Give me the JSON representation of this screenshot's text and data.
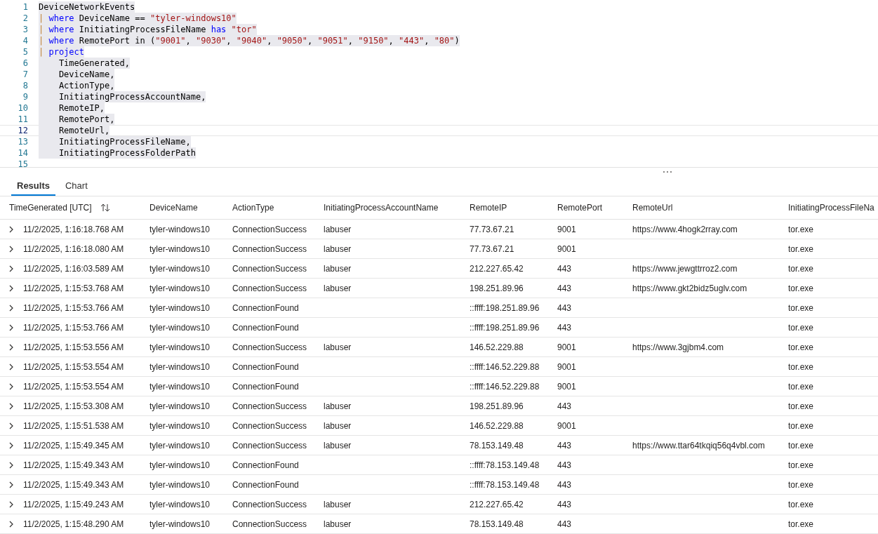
{
  "editor": {
    "lines": [
      {
        "number": "1",
        "current": false,
        "tokens": [
          {
            "kind": "plain",
            "text": "DeviceNetworkEvents"
          }
        ]
      },
      {
        "number": "2",
        "current": false,
        "tokens": [
          {
            "kind": "pipe",
            "text": "|"
          },
          {
            "kind": "keyword",
            "text": " where"
          },
          {
            "kind": "plain",
            "text": " DeviceName == "
          },
          {
            "kind": "string",
            "text": "\"tyler-windows10\""
          }
        ]
      },
      {
        "number": "3",
        "current": false,
        "tokens": [
          {
            "kind": "pipe",
            "text": "|"
          },
          {
            "kind": "keyword",
            "text": " where"
          },
          {
            "kind": "plain",
            "text": " InitiatingProcessFileName "
          },
          {
            "kind": "keyword",
            "text": "has "
          },
          {
            "kind": "string",
            "text": "\"tor\""
          }
        ]
      },
      {
        "number": "4",
        "current": false,
        "tokens": [
          {
            "kind": "pipe",
            "text": "|"
          },
          {
            "kind": "keyword",
            "text": " where"
          },
          {
            "kind": "plain",
            "text": " RemotePort in ("
          },
          {
            "kind": "string",
            "text": "\"9001\""
          },
          {
            "kind": "plain",
            "text": ", "
          },
          {
            "kind": "string",
            "text": "\"9030\""
          },
          {
            "kind": "plain",
            "text": ", "
          },
          {
            "kind": "string",
            "text": "\"9040\""
          },
          {
            "kind": "plain",
            "text": ", "
          },
          {
            "kind": "string",
            "text": "\"9050\""
          },
          {
            "kind": "plain",
            "text": ", "
          },
          {
            "kind": "string",
            "text": "\"9051\""
          },
          {
            "kind": "plain",
            "text": ", "
          },
          {
            "kind": "string",
            "text": "\"9150\""
          },
          {
            "kind": "plain",
            "text": ", "
          },
          {
            "kind": "string",
            "text": "\"443\""
          },
          {
            "kind": "plain",
            "text": ", "
          },
          {
            "kind": "string",
            "text": "\"80\""
          },
          {
            "kind": "plain",
            "text": ")"
          }
        ]
      },
      {
        "number": "5",
        "current": false,
        "tokens": [
          {
            "kind": "pipe",
            "text": "|"
          },
          {
            "kind": "keyword",
            "text": " project"
          }
        ]
      },
      {
        "number": "6",
        "current": false,
        "tokens": [
          {
            "kind": "plain",
            "text": "    TimeGenerated,"
          }
        ]
      },
      {
        "number": "7",
        "current": false,
        "tokens": [
          {
            "kind": "plain",
            "text": "    DeviceName,"
          }
        ]
      },
      {
        "number": "8",
        "current": false,
        "tokens": [
          {
            "kind": "plain",
            "text": "    ActionType,"
          }
        ]
      },
      {
        "number": "9",
        "current": false,
        "tokens": [
          {
            "kind": "plain",
            "text": "    InitiatingProcessAccountName,"
          }
        ]
      },
      {
        "number": "10",
        "current": false,
        "tokens": [
          {
            "kind": "plain",
            "text": "    RemoteIP,"
          }
        ]
      },
      {
        "number": "11",
        "current": false,
        "tokens": [
          {
            "kind": "plain",
            "text": "    RemotePort,"
          }
        ]
      },
      {
        "number": "12",
        "current": true,
        "tokens": [
          {
            "kind": "plain",
            "text": "    RemoteUrl,"
          }
        ]
      },
      {
        "number": "13",
        "current": false,
        "tokens": [
          {
            "kind": "plain",
            "text": "    InitiatingProcessFileName,"
          }
        ]
      },
      {
        "number": "14",
        "current": false,
        "tokens": [
          {
            "kind": "plain",
            "text": "    InitiatingProcessFolderPath"
          }
        ]
      },
      {
        "number": "15",
        "current": false
      }
    ]
  },
  "tabs": [
    {
      "label": "Results",
      "selected": true
    },
    {
      "label": "Chart",
      "selected": false
    }
  ],
  "table": {
    "columns": [
      "TimeGenerated [UTC]",
      "DeviceName",
      "ActionType",
      "InitiatingProcessAccountName",
      "RemoteIP",
      "RemotePort",
      "RemoteUrl",
      "InitiatingProcessFileNa"
    ],
    "rows": [
      [
        "11/2/2025, 1:16:18.768 AM",
        "tyler-windows10",
        "ConnectionSuccess",
        "labuser",
        "77.73.67.21",
        "9001",
        "https://www.4hogk2rray.com",
        "tor.exe"
      ],
      [
        "11/2/2025, 1:16:18.080 AM",
        "tyler-windows10",
        "ConnectionSuccess",
        "labuser",
        "77.73.67.21",
        "9001",
        "",
        "tor.exe"
      ],
      [
        "11/2/2025, 1:16:03.589 AM",
        "tyler-windows10",
        "ConnectionSuccess",
        "labuser",
        "212.227.65.42",
        "443",
        "https://www.jewgttrroz2.com",
        "tor.exe"
      ],
      [
        "11/2/2025, 1:15:53.768 AM",
        "tyler-windows10",
        "ConnectionSuccess",
        "labuser",
        "198.251.89.96",
        "443",
        "https://www.gkt2bidz5uglv.com",
        "tor.exe"
      ],
      [
        "11/2/2025, 1:15:53.766 AM",
        "tyler-windows10",
        "ConnectionFound",
        "",
        "::ffff:198.251.89.96",
        "443",
        "",
        "tor.exe"
      ],
      [
        "11/2/2025, 1:15:53.766 AM",
        "tyler-windows10",
        "ConnectionFound",
        "",
        "::ffff:198.251.89.96",
        "443",
        "",
        "tor.exe"
      ],
      [
        "11/2/2025, 1:15:53.556 AM",
        "tyler-windows10",
        "ConnectionSuccess",
        "labuser",
        "146.52.229.88",
        "9001",
        "https://www.3gjbm4.com",
        "tor.exe"
      ],
      [
        "11/2/2025, 1:15:53.554 AM",
        "tyler-windows10",
        "ConnectionFound",
        "",
        "::ffff:146.52.229.88",
        "9001",
        "",
        "tor.exe"
      ],
      [
        "11/2/2025, 1:15:53.554 AM",
        "tyler-windows10",
        "ConnectionFound",
        "",
        "::ffff:146.52.229.88",
        "9001",
        "",
        "tor.exe"
      ],
      [
        "11/2/2025, 1:15:53.308 AM",
        "tyler-windows10",
        "ConnectionSuccess",
        "labuser",
        "198.251.89.96",
        "443",
        "",
        "tor.exe"
      ],
      [
        "11/2/2025, 1:15:51.538 AM",
        "tyler-windows10",
        "ConnectionSuccess",
        "labuser",
        "146.52.229.88",
        "9001",
        "",
        "tor.exe"
      ],
      [
        "11/2/2025, 1:15:49.345 AM",
        "tyler-windows10",
        "ConnectionSuccess",
        "labuser",
        "78.153.149.48",
        "443",
        "https://www.ttar64tkqiq56q4vbl.com",
        "tor.exe"
      ],
      [
        "11/2/2025, 1:15:49.343 AM",
        "tyler-windows10",
        "ConnectionFound",
        "",
        "::ffff:78.153.149.48",
        "443",
        "",
        "tor.exe"
      ],
      [
        "11/2/2025, 1:15:49.343 AM",
        "tyler-windows10",
        "ConnectionFound",
        "",
        "::ffff:78.153.149.48",
        "443",
        "",
        "tor.exe"
      ],
      [
        "11/2/2025, 1:15:49.243 AM",
        "tyler-windows10",
        "ConnectionSuccess",
        "labuser",
        "212.227.65.42",
        "443",
        "",
        "tor.exe"
      ],
      [
        "11/2/2025, 1:15:48.290 AM",
        "tyler-windows10",
        "ConnectionSuccess",
        "labuser",
        "78.153.149.48",
        "443",
        "",
        "tor.exe"
      ]
    ]
  }
}
